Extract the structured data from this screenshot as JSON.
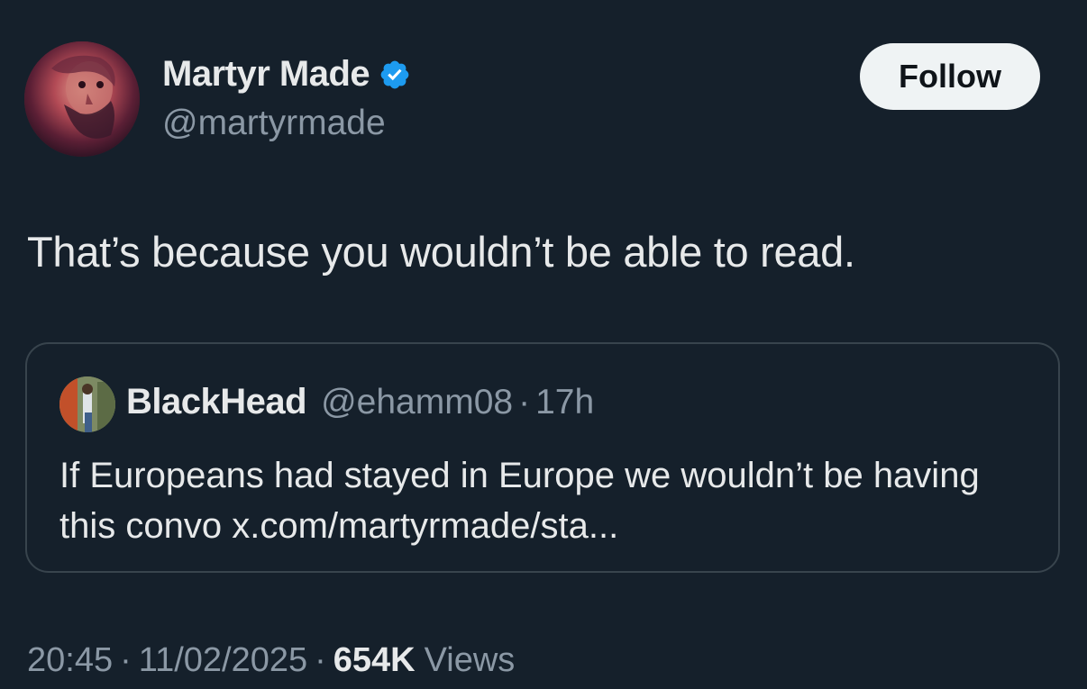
{
  "author": {
    "name": "Martyr Made",
    "handle": "@martyrmade",
    "verified": true,
    "verified_color": "#1d9bf0"
  },
  "follow_button": {
    "label": "Follow"
  },
  "tweet": {
    "text": "That’s because you wouldn’t be able to read."
  },
  "quote": {
    "name": "BlackHead",
    "handle": "@ehamm08",
    "separator": "·",
    "time": "17h",
    "text": "If Europeans had stayed in Europe we wouldn’t be having this convo x.com/martyrmade/sta..."
  },
  "meta": {
    "time": "20:45",
    "separator": "·",
    "date": "11/02/2025",
    "views_count": "654K",
    "views_label": "Views"
  },
  "theme": {
    "background": "#15202b",
    "text_primary": "#e7e9ea",
    "text_secondary": "#8b98a5",
    "border": "#38444d",
    "follow_bg": "#eff3f4"
  }
}
